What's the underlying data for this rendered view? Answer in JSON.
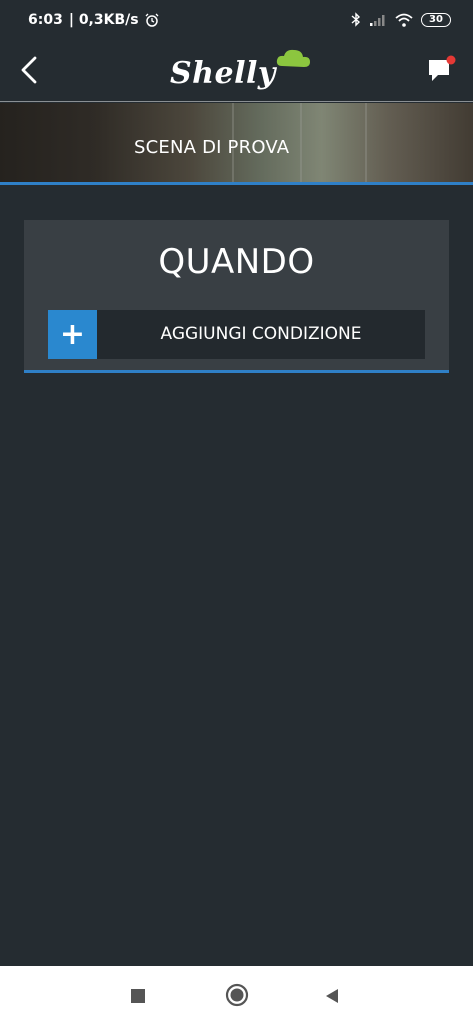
{
  "status_bar": {
    "time": "6:03",
    "network_speed": "| 0,3KB/s",
    "battery": "30",
    "icons": [
      "alarm-icon",
      "bluetooth-icon",
      "signal-icon",
      "wifi-icon",
      "battery-icon"
    ]
  },
  "header": {
    "logo": "Shelly",
    "back_icon": "chevron-left-icon",
    "chat_icon": "chat-notification-icon",
    "notification_color": "#e53935"
  },
  "banner": {
    "title": "SCENA DI PROVA"
  },
  "card": {
    "title": "QUANDO",
    "add_button_icon": "plus-icon",
    "add_button_label": "AGGIUNGI CONDIZIONE"
  },
  "nav_bar": {
    "icons": [
      "recent-apps-icon",
      "home-icon",
      "back-icon"
    ]
  },
  "colors": {
    "background": "#252c31",
    "card": "#393f44",
    "accent": "#2a88cf",
    "logo_cloud": "#8cc63f"
  }
}
